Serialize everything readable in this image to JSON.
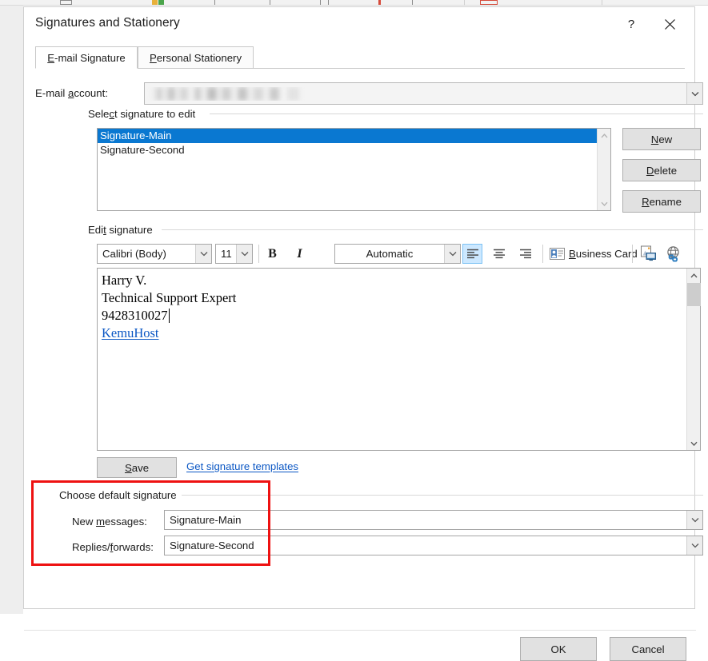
{
  "dialog": {
    "title": "Signatures and Stationery",
    "help_button": "?",
    "close_button": "close-icon"
  },
  "tabs": [
    {
      "id": "email-signature",
      "label": "E-mail Signature",
      "accel": "E",
      "active": true
    },
    {
      "id": "personal-stationery",
      "label": "Personal Stationery",
      "accel": "P",
      "active": false
    }
  ],
  "email_account": {
    "label": "E-mail account:",
    "value": "",
    "redacted": true
  },
  "select_signature": {
    "group_label": "Select signature to edit",
    "items": [
      {
        "label": "Signature-Main",
        "selected": true
      },
      {
        "label": "Signature-Second",
        "selected": false
      }
    ],
    "buttons": {
      "new": "New",
      "delete": "Delete",
      "rename": "Rename"
    }
  },
  "edit_signature": {
    "group_label": "Edit signature",
    "toolbar": {
      "font_family": "Calibri (Body)",
      "font_size": "11",
      "bold": "B",
      "italic": "I",
      "font_color": "Automatic",
      "align_left": "align-left-icon",
      "align_center": "align-center-icon",
      "align_right": "align-right-icon",
      "active_alignment": "left",
      "business_card": "Business Card",
      "insert_picture": "insert-picture-icon",
      "insert_hyperlink": "insert-hyperlink-icon"
    },
    "content_lines": [
      {
        "text": "Harry V.",
        "type": "text"
      },
      {
        "text": "Technical Support Expert",
        "type": "text"
      },
      {
        "text": "9428310027",
        "type": "text",
        "caret_after": true
      },
      {
        "text": "KemuHost",
        "type": "link"
      }
    ],
    "save_button": "Save",
    "templates_link": "Get signature templates"
  },
  "default_signature": {
    "group_label": "Choose default signature",
    "new_messages_label": "New messages:",
    "new_messages_value": "Signature-Main",
    "replies_forwards_label": "Replies/forwards:",
    "replies_forwards_value": "Signature-Second"
  },
  "footer": {
    "ok": "OK",
    "cancel": "Cancel"
  },
  "colors": {
    "selection_blue": "#0a78d1",
    "link_blue": "#0b57c4",
    "annotation_red": "#ee1111",
    "toolbar_active": "#cce8ff",
    "button_face": "#e1e1e1"
  }
}
